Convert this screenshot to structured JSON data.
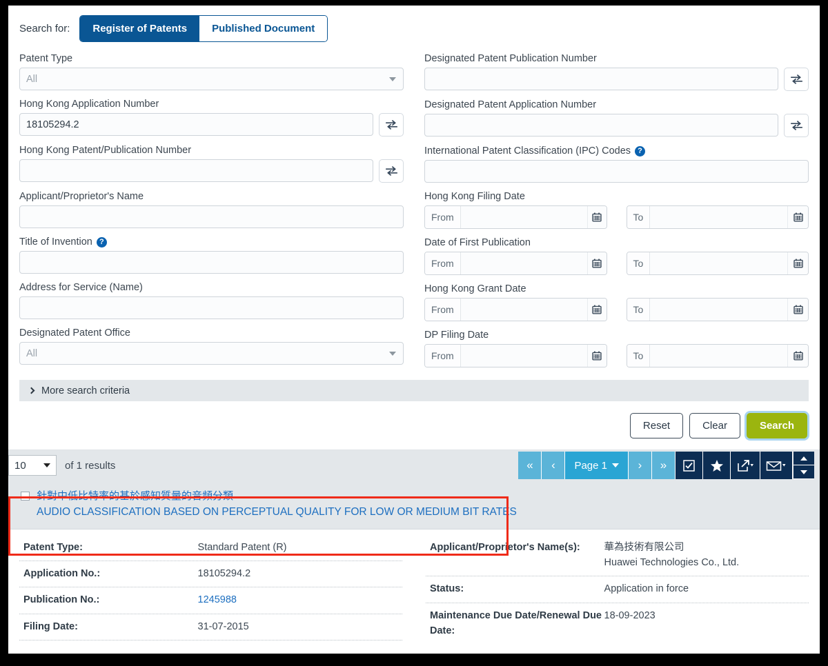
{
  "search": {
    "search_for_label": "Search for:",
    "tabs": [
      {
        "label": "Register of Patents",
        "active": true
      },
      {
        "label": "Published Document",
        "active": false
      }
    ],
    "left_fields": {
      "patent_type": {
        "label": "Patent Type",
        "value": "All",
        "type": "select"
      },
      "hk_application_number": {
        "label": "Hong Kong Application Number",
        "value": "18105294.2"
      },
      "hk_patent_publication_number": {
        "label": "Hong Kong Patent/Publication Number",
        "value": ""
      },
      "applicant_name": {
        "label": "Applicant/Proprietor's Name",
        "value": ""
      },
      "title_of_invention": {
        "label": "Title of Invention",
        "value": "",
        "help": "?"
      },
      "address_for_service": {
        "label": "Address for Service (Name)",
        "value": ""
      },
      "designated_patent_office": {
        "label": "Designated Patent Office",
        "value": "All",
        "type": "select"
      }
    },
    "right_fields": {
      "dp_publication_number": {
        "label": "Designated Patent Publication Number",
        "value": ""
      },
      "dp_application_number": {
        "label": "Designated Patent Application Number",
        "value": ""
      },
      "ipc_codes": {
        "label": "International Patent Classification (IPC) Codes",
        "value": "",
        "help": "?"
      },
      "hk_filing_date": {
        "label": "Hong Kong Filing Date",
        "from_label": "From",
        "to_label": "To",
        "from": "",
        "to": ""
      },
      "date_first_publication": {
        "label": "Date of First Publication",
        "from_label": "From",
        "to_label": "To",
        "from": "",
        "to": ""
      },
      "hk_grant_date": {
        "label": "Hong Kong Grant Date",
        "from_label": "From",
        "to_label": "To",
        "from": "",
        "to": ""
      },
      "dp_filing_date": {
        "label": "DP Filing Date",
        "from_label": "From",
        "to_label": "To",
        "from": "",
        "to": ""
      }
    },
    "more_criteria_label": "More search criteria",
    "buttons": {
      "reset": "Reset",
      "clear": "Clear",
      "search": "Search"
    }
  },
  "results": {
    "per_page": "10",
    "count_text": "of 1 results",
    "pager": {
      "first": "«",
      "prev": "‹",
      "page_label": "Page 1",
      "next": "›",
      "last": "»"
    },
    "item": {
      "title_zh": "針對中低比特率的基於感知質量的音頻分類",
      "title_en": "AUDIO CLASSIFICATION BASED ON PERCEPTUAL QUALITY FOR LOW OR MEDIUM BIT RATES"
    },
    "detail_left": [
      {
        "key": "Patent Type:",
        "value": "Standard Patent (R)",
        "link": false
      },
      {
        "key": "Application No.:",
        "value": "18105294.2",
        "link": false
      },
      {
        "key": "Publication No.:",
        "value": "1245988",
        "link": true
      },
      {
        "key": "Filing Date:",
        "value": "31-07-2015",
        "link": false
      }
    ],
    "detail_right": [
      {
        "key": "Applicant/Proprietor's Name(s):",
        "value": "華為技術有限公司\nHuawei Technologies Co., Ltd.",
        "link": false
      },
      {
        "key": "Status:",
        "value": "Application in force",
        "link": false
      },
      {
        "key": "Maintenance Due Date/Renewal Due Date:",
        "value": "18-09-2023",
        "link": false
      }
    ]
  },
  "colors": {
    "tab_active_bg": "#0a5694",
    "search_button_bg": "#9bb50f",
    "link": "#1d6fc0",
    "annotation_box": "#ef2b19",
    "pager_light": "#5bb4d8",
    "pager_dark": "#0c2d53",
    "panel_grey": "#e3e7ea"
  }
}
